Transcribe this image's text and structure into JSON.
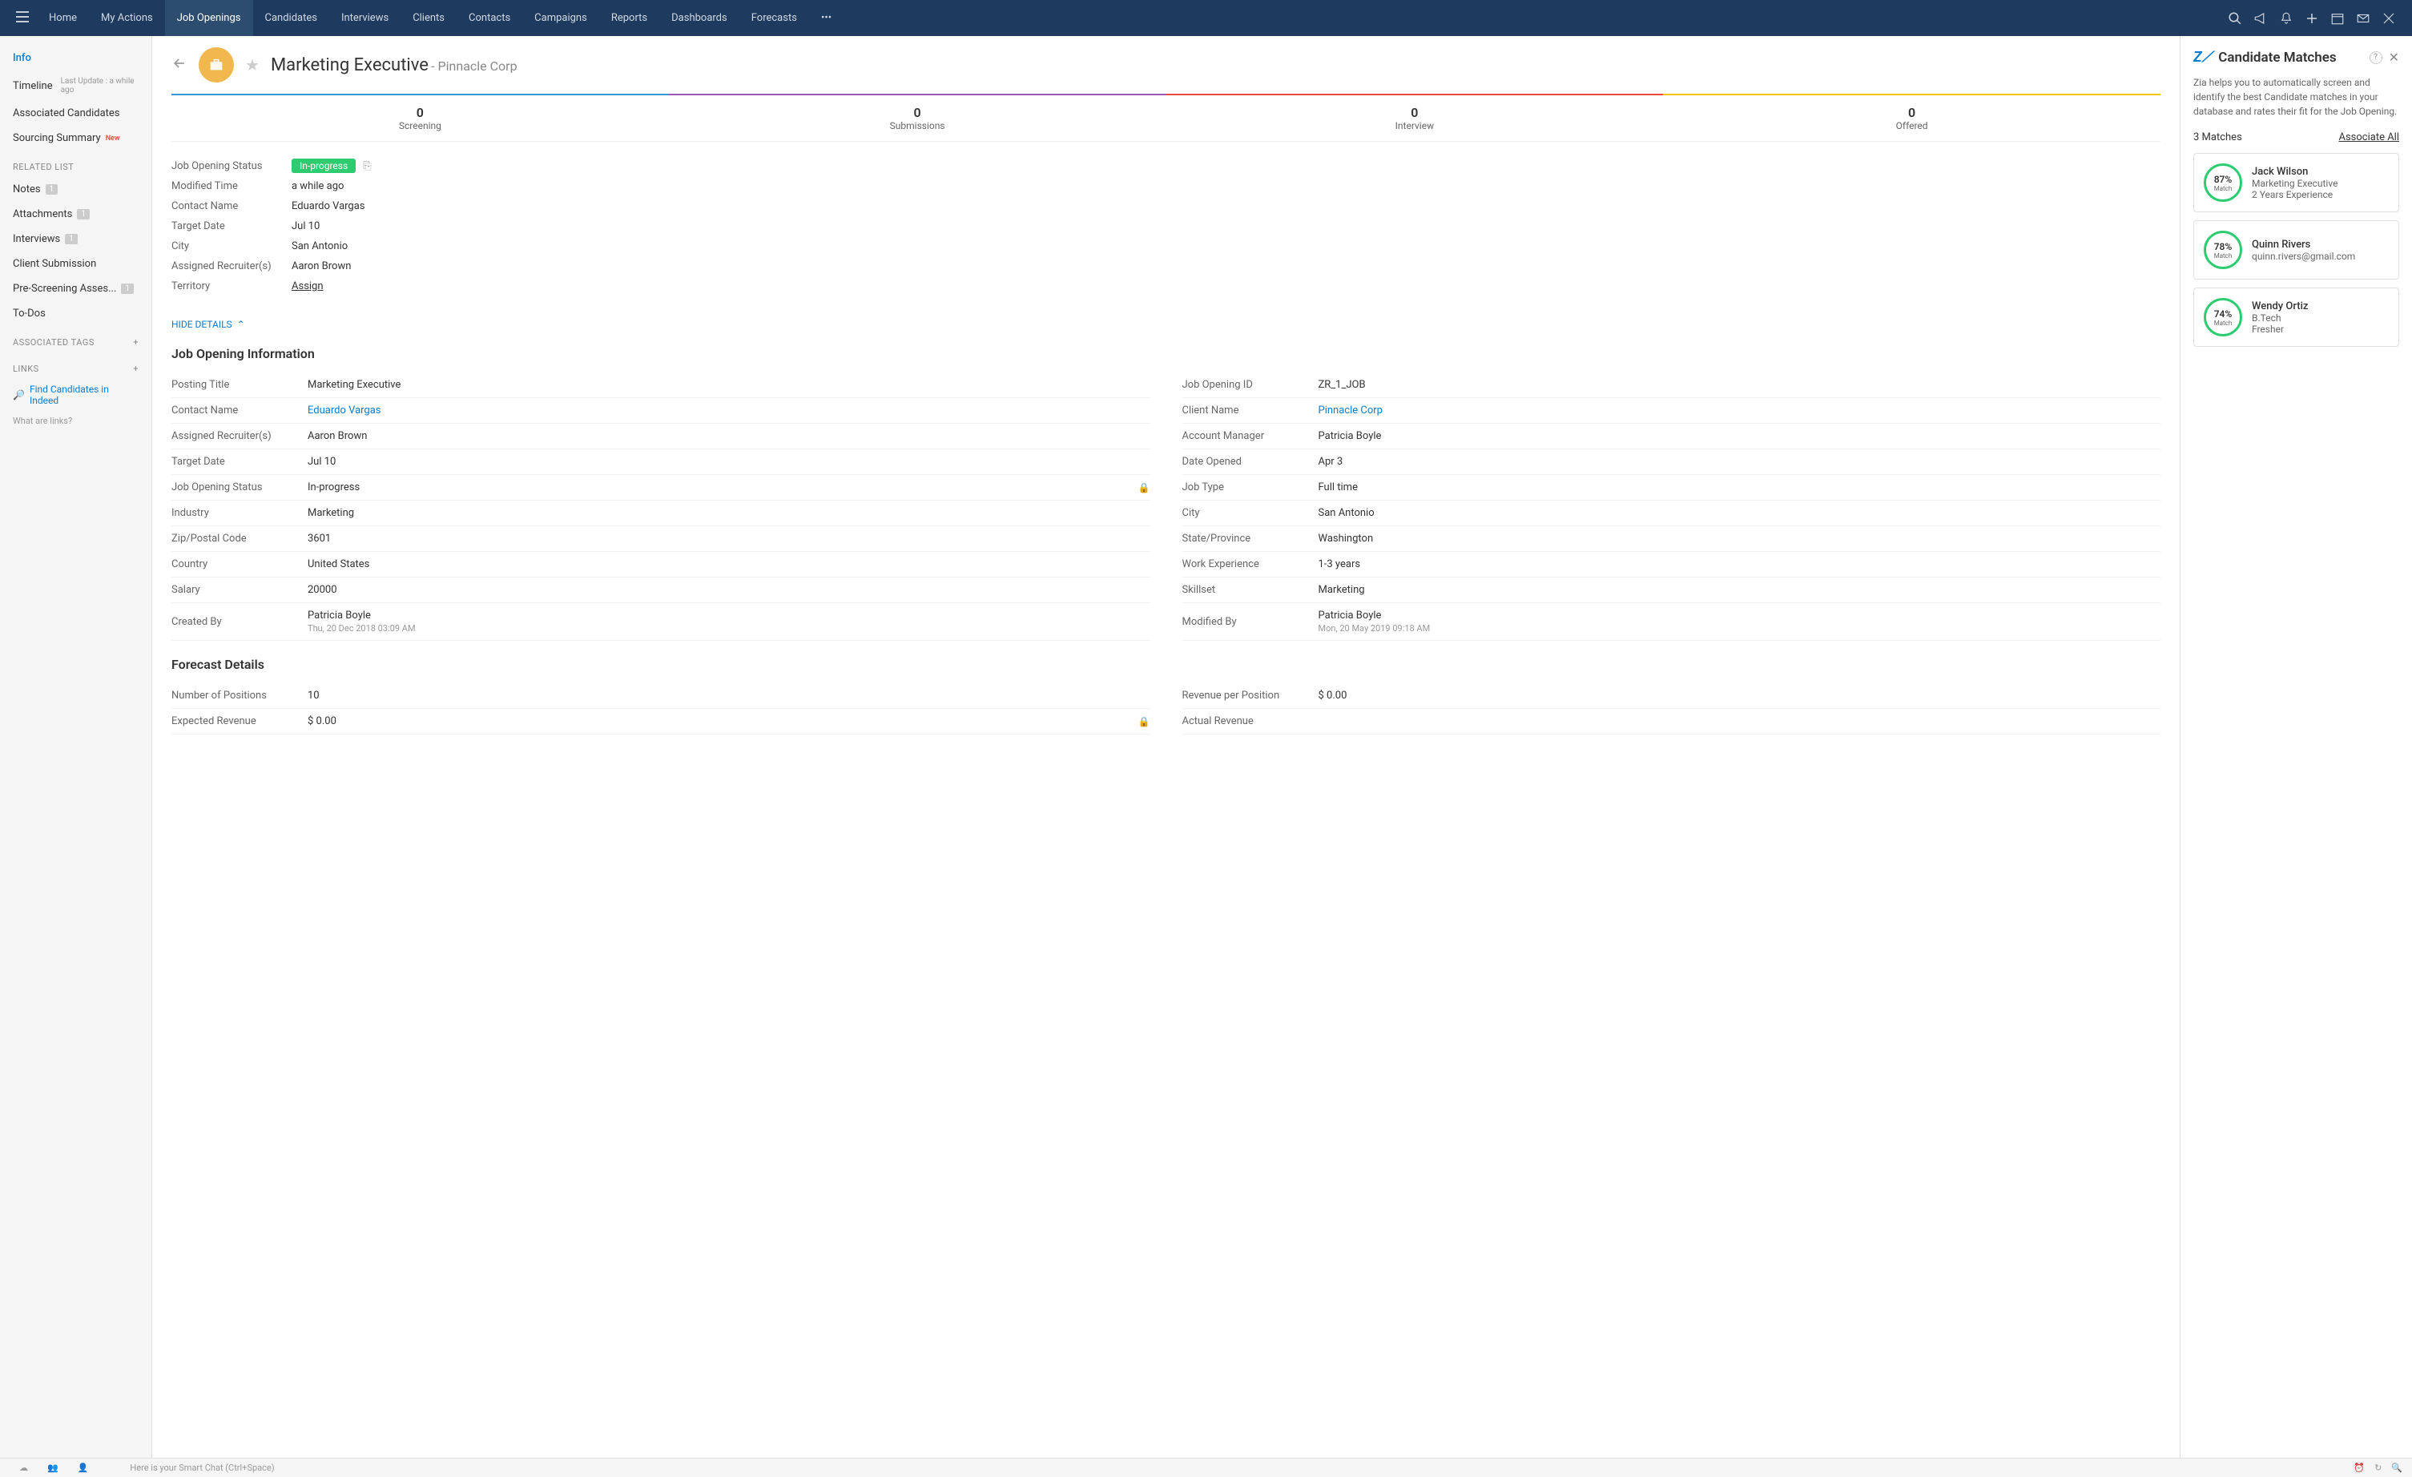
{
  "nav": {
    "tabs": [
      "Home",
      "My Actions",
      "Job Openings",
      "Candidates",
      "Interviews",
      "Clients",
      "Contacts",
      "Campaigns",
      "Reports",
      "Dashboards",
      "Forecasts"
    ],
    "active": "Job Openings"
  },
  "sidebar": {
    "info": "Info",
    "timeline": "Timeline",
    "timeline_sub": "Last Update : a while ago",
    "assoc_cand": "Associated Candidates",
    "sourcing": "Sourcing Summary",
    "sourcing_new": "New",
    "related_head": "RELATED LIST",
    "notes": "Notes",
    "notes_count": "1",
    "attachments": "Attachments",
    "attachments_count": "1",
    "interviews": "Interviews",
    "interviews_count": "1",
    "client_sub": "Client Submission",
    "prescreen": "Pre-Screening Asses...",
    "prescreen_count": "1",
    "todos": "To-Dos",
    "tags_head": "ASSOCIATED TAGS",
    "links_head": "LINKS",
    "indeed": "Find Candidates in Indeed",
    "whatlinks": "What are links?"
  },
  "header": {
    "title": "Marketing Executive",
    "subtitle": "- Pinnacle Corp"
  },
  "pipeline": [
    {
      "num": "0",
      "label": "Screening"
    },
    {
      "num": "0",
      "label": "Submissions"
    },
    {
      "num": "0",
      "label": "Interview"
    },
    {
      "num": "0",
      "label": "Offered"
    }
  ],
  "summary": {
    "status_k": "Job Opening Status",
    "status_v": "In-progress",
    "modified_k": "Modified Time",
    "modified_v": "a while ago",
    "contact_k": "Contact Name",
    "contact_v": "Eduardo Vargas",
    "target_k": "Target Date",
    "target_v": "Jul 10",
    "city_k": "City",
    "city_v": "San Antonio",
    "recruiter_k": "Assigned Recruiter(s)",
    "recruiter_v": "Aaron Brown",
    "territory_k": "Territory",
    "territory_v": "Assign"
  },
  "hide_details": "HIDE DETAILS",
  "info_section": {
    "heading": "Job Opening Information",
    "left": [
      {
        "k": "Posting Title",
        "v": "Marketing Executive"
      },
      {
        "k": "Contact Name",
        "v": "Eduardo Vargas",
        "link": true
      },
      {
        "k": "Assigned Recruiter(s)",
        "v": "Aaron Brown"
      },
      {
        "k": "Target Date",
        "v": "Jul 10"
      },
      {
        "k": "Job Opening Status",
        "v": "In-progress",
        "lock": true
      },
      {
        "k": "Industry",
        "v": "Marketing"
      },
      {
        "k": "Zip/Postal Code",
        "v": "3601"
      },
      {
        "k": "Country",
        "v": "United States"
      },
      {
        "k": "Salary",
        "v": "20000"
      },
      {
        "k": "Created By",
        "v": "Patricia Boyle",
        "ts": "Thu, 20 Dec 2018 03:09 AM"
      }
    ],
    "right": [
      {
        "k": "Job Opening ID",
        "v": "ZR_1_JOB"
      },
      {
        "k": "Client Name",
        "v": "Pinnacle Corp",
        "link": true
      },
      {
        "k": "Account Manager",
        "v": "Patricia Boyle"
      },
      {
        "k": "Date Opened",
        "v": "Apr 3"
      },
      {
        "k": "Job Type",
        "v": "Full time"
      },
      {
        "k": "City",
        "v": "San Antonio"
      },
      {
        "k": "State/Province",
        "v": "Washington"
      },
      {
        "k": "Work Experience",
        "v": "1-3 years"
      },
      {
        "k": "Skillset",
        "v": "Marketing"
      },
      {
        "k": "Modified By",
        "v": "Patricia Boyle",
        "ts": "Mon, 20 May 2019 09:18 AM"
      }
    ]
  },
  "forecast": {
    "heading": "Forecast Details",
    "left": [
      {
        "k": "Number of Positions",
        "v": "10"
      },
      {
        "k": "Expected Revenue",
        "v": "$ 0.00",
        "lock": true
      }
    ],
    "right": [
      {
        "k": "Revenue per Position",
        "v": "$ 0.00"
      },
      {
        "k": "Actual Revenue",
        "v": ""
      }
    ]
  },
  "rightpanel": {
    "title": "Candidate Matches",
    "desc": "Zia helps you to automatically screen and identify the best Candidate matches in your database and rates their fit for the Job Opening.",
    "count": "3 Matches",
    "assoc_all": "Associate All",
    "matches": [
      {
        "pct": "87%",
        "name": "Jack Wilson",
        "role": "Marketing Executive",
        "exp": "2 Years Experience"
      },
      {
        "pct": "78%",
        "name": "Quinn Rivers",
        "role": "quinn.rivers@gmail.com",
        "exp": ""
      },
      {
        "pct": "74%",
        "name": "Wendy Ortiz",
        "role": "B.Tech",
        "exp": "Fresher"
      }
    ]
  },
  "bottombar": {
    "smartchat": "Here is your Smart Chat (Ctrl+Space)"
  }
}
